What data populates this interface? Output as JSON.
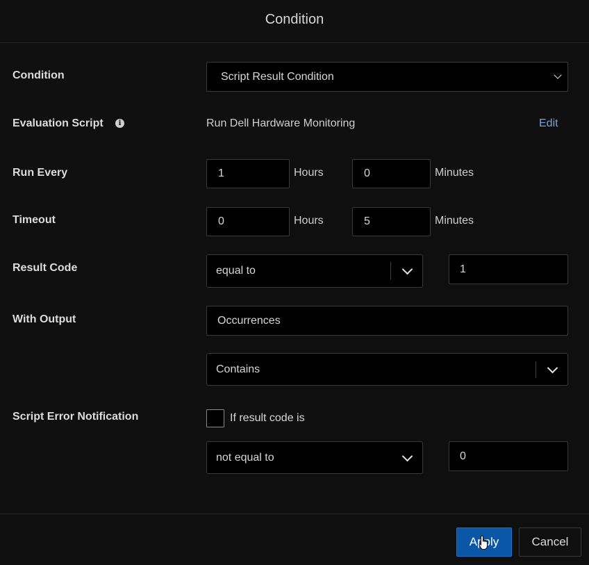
{
  "dialog": {
    "title": "Condition"
  },
  "condition": {
    "label": "Condition",
    "value": "Script Result Condition"
  },
  "evaluation_script": {
    "label": "Evaluation Script",
    "value": "Run Dell Hardware Monitoring",
    "edit_label": "Edit"
  },
  "run_every": {
    "label": "Run Every",
    "hours": "1",
    "hours_unit": "Hours",
    "minutes": "0",
    "minutes_unit": "Minutes"
  },
  "timeout": {
    "label": "Timeout",
    "hours": "0",
    "hours_unit": "Hours",
    "minutes": "5",
    "minutes_unit": "Minutes"
  },
  "result_code": {
    "label": "Result Code",
    "operator": "equal to",
    "value": "1"
  },
  "with_output": {
    "label": "With Output",
    "text": "Occurrences",
    "match": "Contains"
  },
  "script_error": {
    "label": "Script Error Notification",
    "checkbox_label": "If result code is",
    "operator": "not equal to",
    "value": "0"
  },
  "footer": {
    "apply_label": "Apply",
    "cancel_label": "Cancel"
  },
  "colors": {
    "background": "#0f0f0f",
    "accent": "#0a57a8",
    "link": "#6fa8dc"
  }
}
